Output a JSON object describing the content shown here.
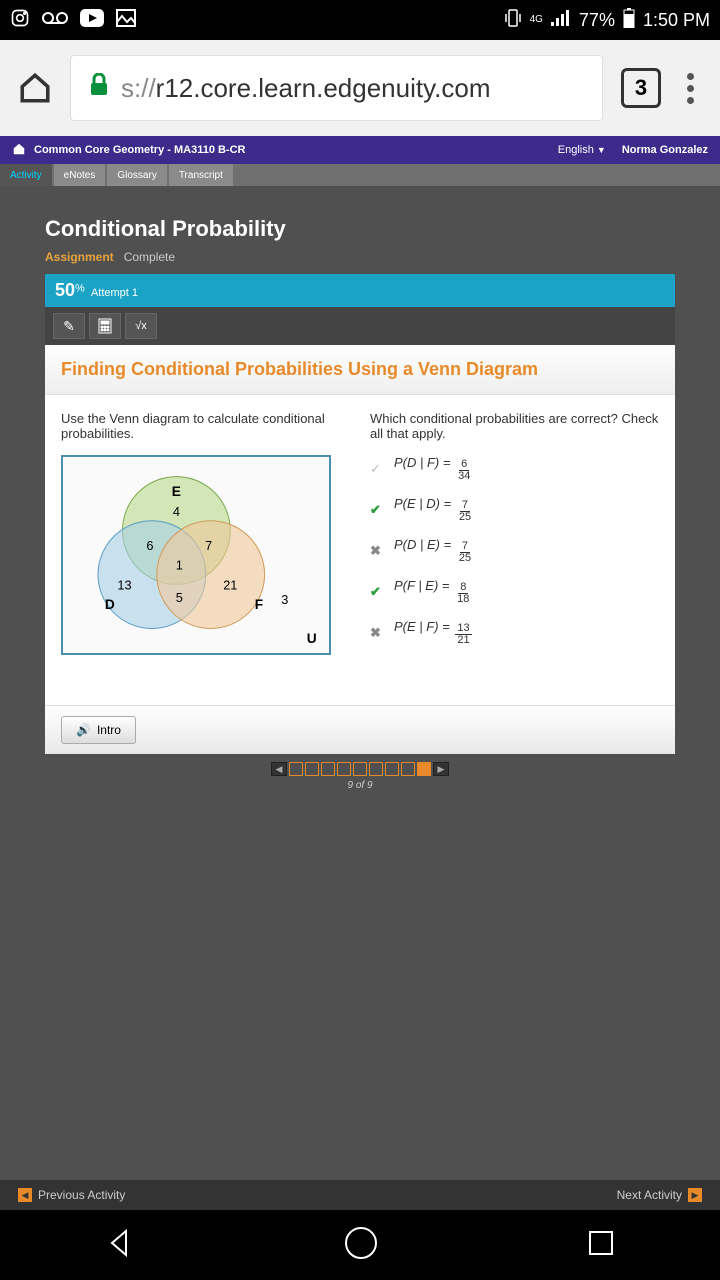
{
  "status": {
    "battery": "77%",
    "time": "1:50 PM",
    "network": "4G"
  },
  "browser": {
    "url_prefix": "s://",
    "url": "r12.core.learn.edgenuity.com",
    "tab_count": "3"
  },
  "course": {
    "name": "Common Core Geometry - MA3110 B-CR",
    "language": "English",
    "user": "Norma Gonzalez"
  },
  "tabs": {
    "activity": "Activity",
    "enotes": "eNotes",
    "glossary": "Glossary",
    "transcript": "Transcript"
  },
  "lesson": {
    "title": "Conditional Probability",
    "type": "Assignment",
    "status": "Complete",
    "score": "50",
    "score_unit": "%",
    "attempt": "Attempt 1"
  },
  "card": {
    "title": "Finding Conditional Probabilities Using a Venn Diagram",
    "left_prompt": "Use the Venn diagram to calculate conditional probabilities.",
    "right_prompt": "Which conditional probabilities are correct? Check all that apply."
  },
  "venn": {
    "E": "E",
    "D": "D",
    "F": "F",
    "U": "U",
    "only_E": "4",
    "only_D": "13",
    "only_F": "21",
    "DE": "6",
    "EF": "7",
    "DF": "5",
    "DEF": "1",
    "outside": "3"
  },
  "answers": [
    {
      "mark": "grey",
      "glyph": "✓",
      "expr": "P(D | F) =",
      "num": "6",
      "den": "34"
    },
    {
      "mark": "green",
      "glyph": "✔",
      "expr": "P(E | D) =",
      "num": "7",
      "den": "25"
    },
    {
      "mark": "red",
      "glyph": "✖",
      "expr": "P(D | E) =",
      "num": "7",
      "den": "25"
    },
    {
      "mark": "green",
      "glyph": "✔",
      "expr": "P(F | E) =",
      "num": "8",
      "den": "18"
    },
    {
      "mark": "red",
      "glyph": "✖",
      "expr": "P(E | F) =",
      "num": "13",
      "den": "21"
    }
  ],
  "intro_btn": "Intro",
  "pager": {
    "total": 9,
    "current": 9,
    "label": "9 of 9"
  },
  "footer": {
    "prev": "Previous Activity",
    "next": "Next Activity"
  }
}
